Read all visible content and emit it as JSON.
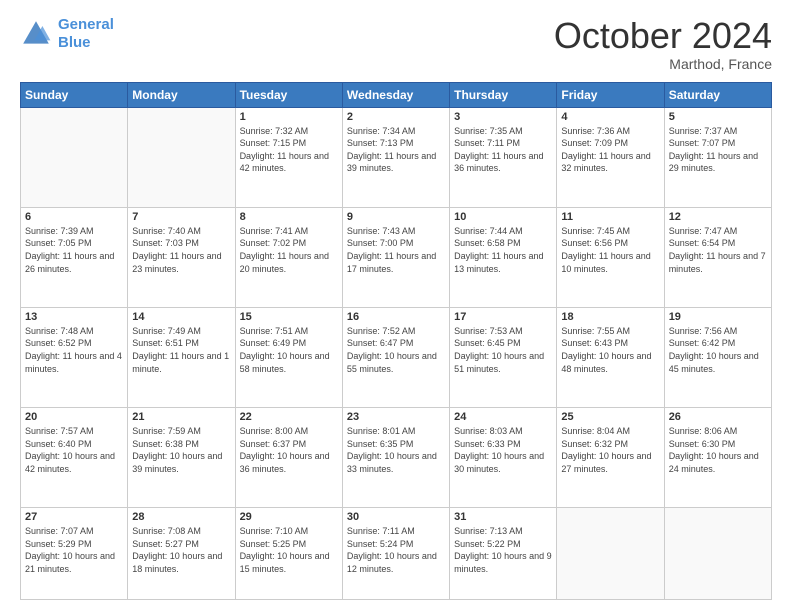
{
  "logo": {
    "line1": "General",
    "line2": "Blue"
  },
  "header": {
    "month": "October 2024",
    "location": "Marthod, France"
  },
  "days_of_week": [
    "Sunday",
    "Monday",
    "Tuesday",
    "Wednesday",
    "Thursday",
    "Friday",
    "Saturday"
  ],
  "weeks": [
    [
      {
        "day": "",
        "sunrise": "",
        "sunset": "",
        "daylight": ""
      },
      {
        "day": "",
        "sunrise": "",
        "sunset": "",
        "daylight": ""
      },
      {
        "day": "1",
        "sunrise": "Sunrise: 7:32 AM",
        "sunset": "Sunset: 7:15 PM",
        "daylight": "Daylight: 11 hours and 42 minutes."
      },
      {
        "day": "2",
        "sunrise": "Sunrise: 7:34 AM",
        "sunset": "Sunset: 7:13 PM",
        "daylight": "Daylight: 11 hours and 39 minutes."
      },
      {
        "day": "3",
        "sunrise": "Sunrise: 7:35 AM",
        "sunset": "Sunset: 7:11 PM",
        "daylight": "Daylight: 11 hours and 36 minutes."
      },
      {
        "day": "4",
        "sunrise": "Sunrise: 7:36 AM",
        "sunset": "Sunset: 7:09 PM",
        "daylight": "Daylight: 11 hours and 32 minutes."
      },
      {
        "day": "5",
        "sunrise": "Sunrise: 7:37 AM",
        "sunset": "Sunset: 7:07 PM",
        "daylight": "Daylight: 11 hours and 29 minutes."
      }
    ],
    [
      {
        "day": "6",
        "sunrise": "Sunrise: 7:39 AM",
        "sunset": "Sunset: 7:05 PM",
        "daylight": "Daylight: 11 hours and 26 minutes."
      },
      {
        "day": "7",
        "sunrise": "Sunrise: 7:40 AM",
        "sunset": "Sunset: 7:03 PM",
        "daylight": "Daylight: 11 hours and 23 minutes."
      },
      {
        "day": "8",
        "sunrise": "Sunrise: 7:41 AM",
        "sunset": "Sunset: 7:02 PM",
        "daylight": "Daylight: 11 hours and 20 minutes."
      },
      {
        "day": "9",
        "sunrise": "Sunrise: 7:43 AM",
        "sunset": "Sunset: 7:00 PM",
        "daylight": "Daylight: 11 hours and 17 minutes."
      },
      {
        "day": "10",
        "sunrise": "Sunrise: 7:44 AM",
        "sunset": "Sunset: 6:58 PM",
        "daylight": "Daylight: 11 hours and 13 minutes."
      },
      {
        "day": "11",
        "sunrise": "Sunrise: 7:45 AM",
        "sunset": "Sunset: 6:56 PM",
        "daylight": "Daylight: 11 hours and 10 minutes."
      },
      {
        "day": "12",
        "sunrise": "Sunrise: 7:47 AM",
        "sunset": "Sunset: 6:54 PM",
        "daylight": "Daylight: 11 hours and 7 minutes."
      }
    ],
    [
      {
        "day": "13",
        "sunrise": "Sunrise: 7:48 AM",
        "sunset": "Sunset: 6:52 PM",
        "daylight": "Daylight: 11 hours and 4 minutes."
      },
      {
        "day": "14",
        "sunrise": "Sunrise: 7:49 AM",
        "sunset": "Sunset: 6:51 PM",
        "daylight": "Daylight: 11 hours and 1 minute."
      },
      {
        "day": "15",
        "sunrise": "Sunrise: 7:51 AM",
        "sunset": "Sunset: 6:49 PM",
        "daylight": "Daylight: 10 hours and 58 minutes."
      },
      {
        "day": "16",
        "sunrise": "Sunrise: 7:52 AM",
        "sunset": "Sunset: 6:47 PM",
        "daylight": "Daylight: 10 hours and 55 minutes."
      },
      {
        "day": "17",
        "sunrise": "Sunrise: 7:53 AM",
        "sunset": "Sunset: 6:45 PM",
        "daylight": "Daylight: 10 hours and 51 minutes."
      },
      {
        "day": "18",
        "sunrise": "Sunrise: 7:55 AM",
        "sunset": "Sunset: 6:43 PM",
        "daylight": "Daylight: 10 hours and 48 minutes."
      },
      {
        "day": "19",
        "sunrise": "Sunrise: 7:56 AM",
        "sunset": "Sunset: 6:42 PM",
        "daylight": "Daylight: 10 hours and 45 minutes."
      }
    ],
    [
      {
        "day": "20",
        "sunrise": "Sunrise: 7:57 AM",
        "sunset": "Sunset: 6:40 PM",
        "daylight": "Daylight: 10 hours and 42 minutes."
      },
      {
        "day": "21",
        "sunrise": "Sunrise: 7:59 AM",
        "sunset": "Sunset: 6:38 PM",
        "daylight": "Daylight: 10 hours and 39 minutes."
      },
      {
        "day": "22",
        "sunrise": "Sunrise: 8:00 AM",
        "sunset": "Sunset: 6:37 PM",
        "daylight": "Daylight: 10 hours and 36 minutes."
      },
      {
        "day": "23",
        "sunrise": "Sunrise: 8:01 AM",
        "sunset": "Sunset: 6:35 PM",
        "daylight": "Daylight: 10 hours and 33 minutes."
      },
      {
        "day": "24",
        "sunrise": "Sunrise: 8:03 AM",
        "sunset": "Sunset: 6:33 PM",
        "daylight": "Daylight: 10 hours and 30 minutes."
      },
      {
        "day": "25",
        "sunrise": "Sunrise: 8:04 AM",
        "sunset": "Sunset: 6:32 PM",
        "daylight": "Daylight: 10 hours and 27 minutes."
      },
      {
        "day": "26",
        "sunrise": "Sunrise: 8:06 AM",
        "sunset": "Sunset: 6:30 PM",
        "daylight": "Daylight: 10 hours and 24 minutes."
      }
    ],
    [
      {
        "day": "27",
        "sunrise": "Sunrise: 7:07 AM",
        "sunset": "Sunset: 5:29 PM",
        "daylight": "Daylight: 10 hours and 21 minutes."
      },
      {
        "day": "28",
        "sunrise": "Sunrise: 7:08 AM",
        "sunset": "Sunset: 5:27 PM",
        "daylight": "Daylight: 10 hours and 18 minutes."
      },
      {
        "day": "29",
        "sunrise": "Sunrise: 7:10 AM",
        "sunset": "Sunset: 5:25 PM",
        "daylight": "Daylight: 10 hours and 15 minutes."
      },
      {
        "day": "30",
        "sunrise": "Sunrise: 7:11 AM",
        "sunset": "Sunset: 5:24 PM",
        "daylight": "Daylight: 10 hours and 12 minutes."
      },
      {
        "day": "31",
        "sunrise": "Sunrise: 7:13 AM",
        "sunset": "Sunset: 5:22 PM",
        "daylight": "Daylight: 10 hours and 9 minutes."
      },
      {
        "day": "",
        "sunrise": "",
        "sunset": "",
        "daylight": ""
      },
      {
        "day": "",
        "sunrise": "",
        "sunset": "",
        "daylight": ""
      }
    ]
  ]
}
